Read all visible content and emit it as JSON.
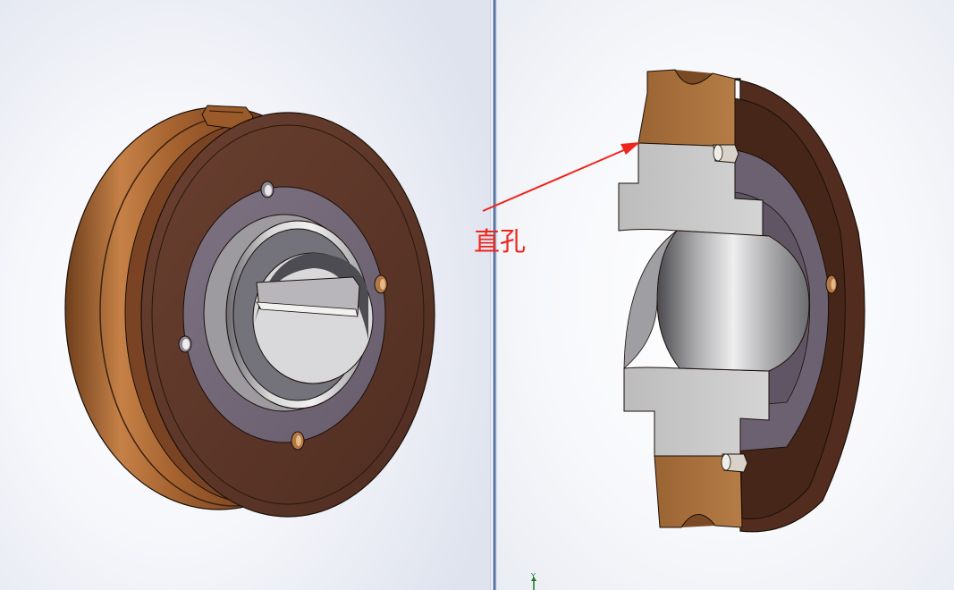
{
  "annotation": {
    "label": "直孔",
    "color": "#f0241b"
  },
  "triad": {
    "axis_label": "Y",
    "color": "#1a7a25"
  },
  "colors": {
    "bronze_light": "#b1733a",
    "bronze_dark": "#5c3524",
    "hub_purple": "#726776",
    "bore_steel": "#c8c6c8",
    "viewport_divider": "#5a74a5"
  },
  "icons": {
    "split_grip": "splitter-handle-icon",
    "triad": "axis-triad-icon"
  }
}
